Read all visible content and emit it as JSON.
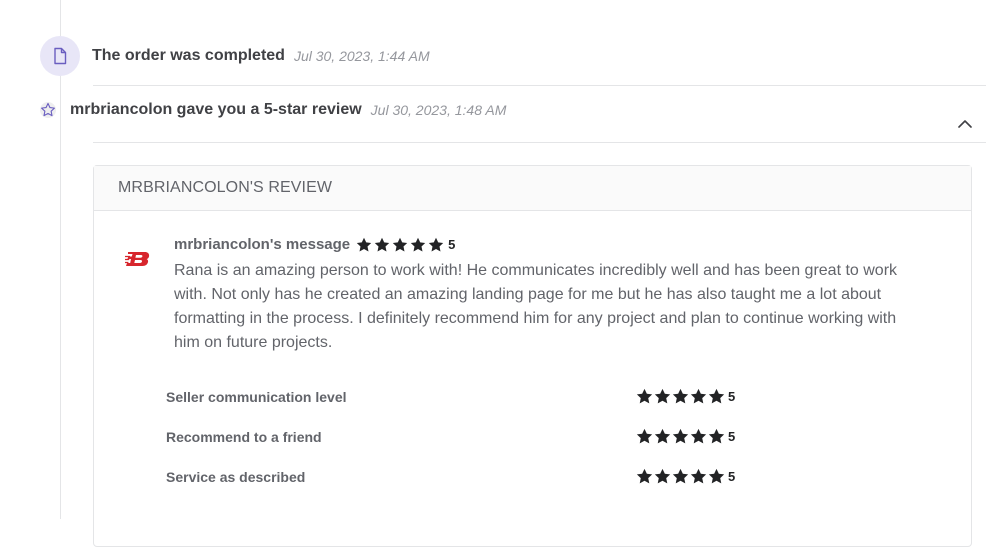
{
  "timeline": {
    "events": [
      {
        "title": "The order was completed",
        "time": "Jul 30, 2023, 1:44 AM",
        "icon": "document-icon"
      },
      {
        "title": "mrbriancolon gave you a 5-star review",
        "time": "Jul 30, 2023, 1:48 AM",
        "icon": "star-outline-icon"
      }
    ]
  },
  "review": {
    "header": "MRBRIANCOLON'S REVIEW",
    "message_author": "mrbriancolon's message",
    "message_rating": 5,
    "message_score": "5",
    "message_text": "Rana is an amazing person to work with! He communicates incredibly well and has been great to work with. Not only has he created an amazing landing page for me but he has also taught me a lot about formatting in the process. I definitely recommend him for any project and plan to continue working with him on future projects.",
    "ratings": [
      {
        "label": "Seller communication level",
        "rating": 5,
        "score": "5"
      },
      {
        "label": "Recommend to a friend",
        "rating": 5,
        "score": "5"
      },
      {
        "label": "Service as described",
        "rating": 5,
        "score": "5"
      }
    ]
  },
  "colors": {
    "star_filled": "#222325",
    "logo_red": "#d7262d",
    "icon_purple": "#6a5ec0",
    "doc_icon_bg": "#e8e6f7"
  }
}
